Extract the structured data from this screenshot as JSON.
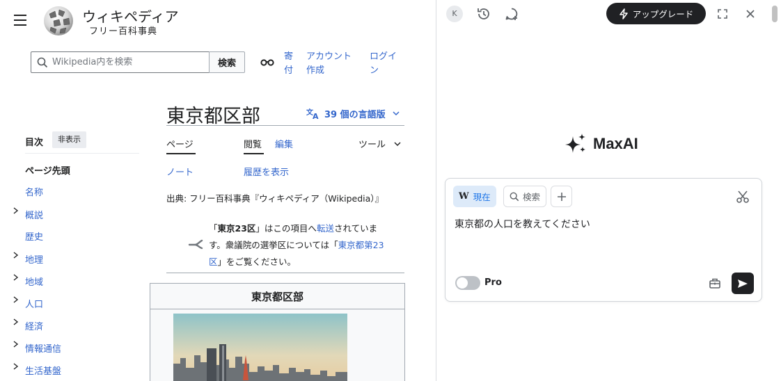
{
  "wiki": {
    "logo": {
      "name": "ウィキペディア",
      "tagline": "フリー百科事典"
    },
    "search": {
      "placeholder": "Wikipedia内を検索",
      "button": "検索"
    },
    "top_links": {
      "donate_line1": "寄",
      "donate_line2": "付",
      "create_account_line1": "アカウント",
      "create_account_line2": "作成",
      "login_line1": "ログイ",
      "login_line2": "ン"
    },
    "toc": {
      "title": "目次",
      "hide": "非表示",
      "top": "ページ先頭",
      "items": [
        "名称",
        "概説",
        "歴史",
        "地理",
        "地域",
        "人口",
        "経済",
        "情報通信",
        "生活基盤"
      ]
    },
    "article": {
      "title": "東京都区部",
      "languages": "39 個の言語版",
      "tabs": {
        "page": "ページ",
        "talk": "ノート",
        "read": "閲覧",
        "edit": "編集",
        "history": "履歴を表示",
        "tools": "ツール"
      },
      "source": "出典: フリー百科事典『ウィキペディア（Wikipedia）』",
      "hatnote": {
        "quote_open": "「",
        "bold_term": "東京23区",
        "part1": "」はこの項目へ",
        "redirect": "転送",
        "part2": "されています。衆議院の選挙区については「",
        "link": "東京都第23区",
        "part3": "」をご覧ください。"
      },
      "infobox_title": "東京都区部"
    }
  },
  "maxai": {
    "avatar_letter": "K",
    "upgrade": "アップグレード",
    "brand": "MaxAI",
    "chips": {
      "current": "現在",
      "current_icon_letter": "W",
      "search": "検索"
    },
    "prompt_value": "東京都の人口を教えてください",
    "pro_label": "Pro",
    "colors": {
      "accent_dark": "#202124",
      "chip_bg": "#ddeaf9",
      "link": "#3366cc"
    }
  }
}
